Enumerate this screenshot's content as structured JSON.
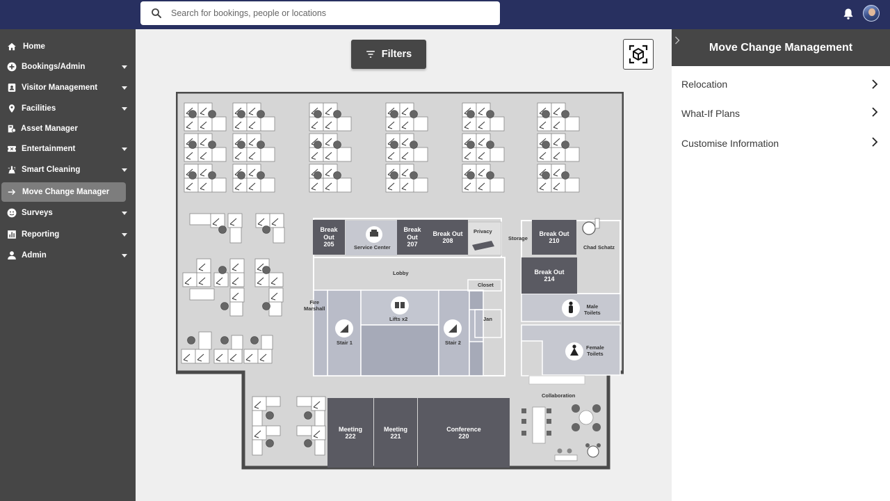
{
  "search": {
    "placeholder": "Search for bookings, people or locations"
  },
  "header": {
    "notifications_icon": "bell-icon",
    "avatar": "user-avatar"
  },
  "sidebar": {
    "items": [
      {
        "label": "Home",
        "icon": "home-icon",
        "has_children": false
      },
      {
        "label": "Bookings/Admin",
        "icon": "plus-circle-icon",
        "has_children": true
      },
      {
        "label": "Visitor Management",
        "icon": "badge-icon",
        "has_children": true
      },
      {
        "label": "Facilities",
        "icon": "location-pin-icon",
        "has_children": true
      },
      {
        "label": "Asset Manager",
        "icon": "asset-icon",
        "has_children": false
      },
      {
        "label": "Entertainment",
        "icon": "ticket-icon",
        "has_children": true
      },
      {
        "label": "Smart Cleaning",
        "icon": "cleaning-icon",
        "has_children": true
      },
      {
        "label": "Move Change Manager",
        "icon": "arrow-right-icon",
        "has_children": false,
        "active": true
      },
      {
        "label": "Surveys",
        "icon": "smiley-icon",
        "has_children": true
      },
      {
        "label": "Reporting",
        "icon": "bar-chart-icon",
        "has_children": true
      },
      {
        "label": "Admin",
        "icon": "person-icon",
        "has_children": true
      }
    ]
  },
  "toolbar": {
    "filters_label": "Filters",
    "ar_icon": "ar-cube-icon"
  },
  "floorplan": {
    "rooms": {
      "b205": "Break\nOut\n205",
      "service": "Service Center",
      "b207": "Break\nOut\n207",
      "b208": "Break Out\n208",
      "privacy": "Privacy",
      "storage": "Storage",
      "b210": "Break Out\n210",
      "chad": "Chad Schatz",
      "b214": "Break Out\n214",
      "lobby": "Lobby",
      "closet": "Closet",
      "fire": "Fire\nMarshall",
      "lifts": "Lifts x2",
      "jan": "Jan",
      "stair1": "Stair 1",
      "stair2": "Stair 2",
      "male": "Male\nToilets",
      "female": "Female\nToilets",
      "collab": "Collaboration",
      "m222": "Meeting\n222",
      "m221": "Meeting\n221",
      "c220": "Conference\n220"
    }
  },
  "panel": {
    "title": "Move Change Management",
    "items": [
      {
        "label": "Relocation"
      },
      {
        "label": "What-If Plans"
      },
      {
        "label": "Customise Information"
      }
    ]
  }
}
